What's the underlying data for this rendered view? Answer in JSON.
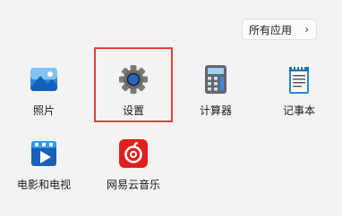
{
  "header": {
    "all_apps_label": "所有应用",
    "all_apps_chevron": "›"
  },
  "apps": [
    {
      "label": "照片",
      "icon": "photos-icon"
    },
    {
      "label": "设置",
      "icon": "settings-gear-icon"
    },
    {
      "label": "计算器",
      "icon": "calculator-icon"
    },
    {
      "label": "记事本",
      "icon": "notepad-icon"
    },
    {
      "label": "电影和电视",
      "icon": "movies-tv-icon"
    },
    {
      "label": "网易云音乐",
      "icon": "netease-music-icon"
    }
  ],
  "colors": {
    "background": "#f3f3f3",
    "highlight_border": "#e0403a",
    "netease_red": "#e0201e"
  }
}
